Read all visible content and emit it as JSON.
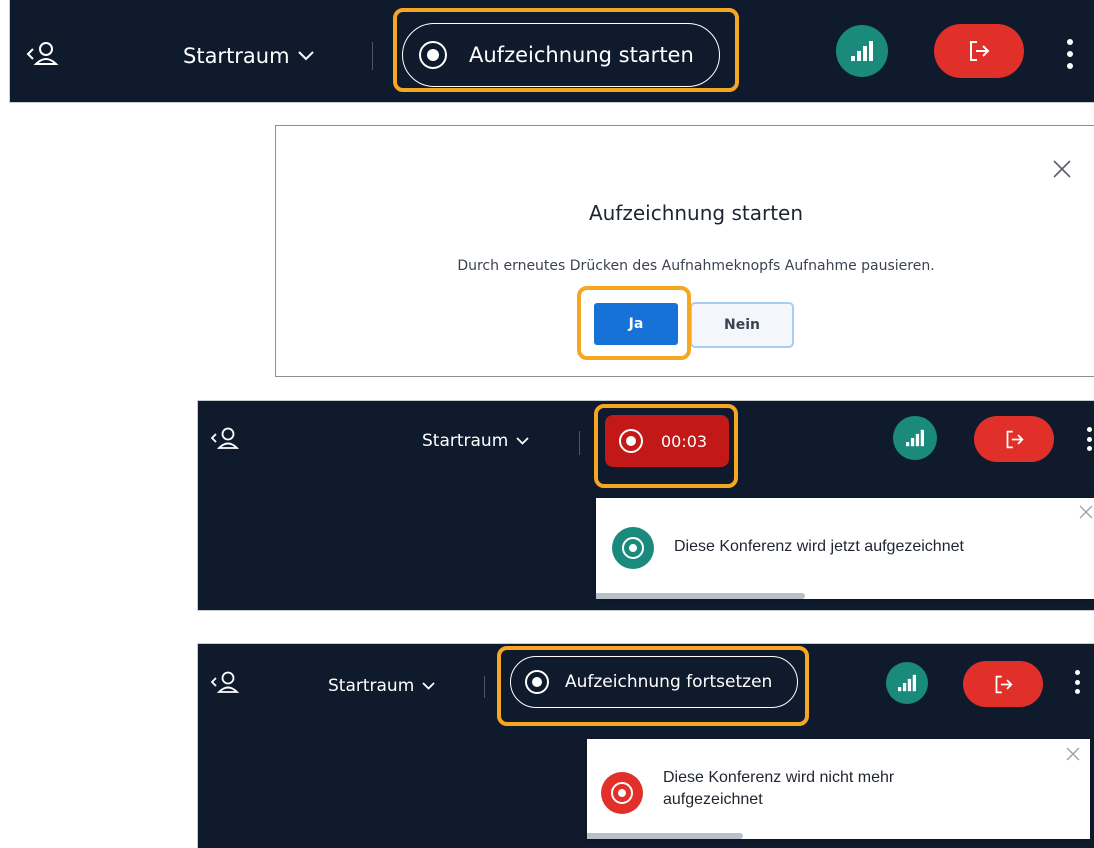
{
  "bar1": {
    "room": "Startraum",
    "record_label": "Aufzeichnung starten"
  },
  "dialog": {
    "title": "Aufzeichnung starten",
    "message": "Durch erneutes Drücken des Aufnahmeknopfs Aufnahme pausieren.",
    "yes_label": "Ja",
    "no_label": "Nein"
  },
  "bar2": {
    "room": "Startraum",
    "timer": "00:03",
    "toast_message": "Diese Konferenz wird jetzt aufgezeichnet",
    "toast_progress": 0.42
  },
  "bar3": {
    "room": "Startraum",
    "record_label": "Aufzeichnung fortsetzen",
    "toast_message_line1": "Diese Konferenz wird nicht mehr",
    "toast_message_line2": "aufgezeichnet",
    "toast_progress": 0.31
  },
  "colors": {
    "bar_bg": "#0f1b2d",
    "highlight": "#f5a623",
    "leave": "#e12f2a",
    "connection": "#1a8a7c",
    "primary": "#1672d6",
    "recording_active": "#c21818"
  },
  "icons": {
    "user_toggle": "user-list-icon",
    "room_chevron": "chevron-down-icon",
    "record": "record-icon",
    "connection": "signal-bars-icon",
    "leave": "leave-icon",
    "more": "kebab-menu-icon",
    "close": "close-icon"
  }
}
